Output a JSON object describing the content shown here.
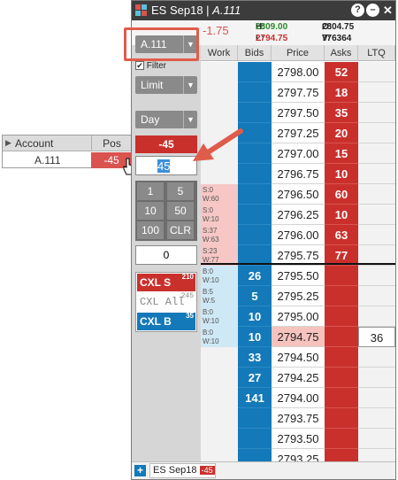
{
  "colors": {
    "ask_red": "#c9302c",
    "bid_blue": "#1479b8",
    "title_bg": "#3c3c3c",
    "accent_red": "#d9534f",
    "highlight": "#e05c4a"
  },
  "popup": {
    "header": {
      "account": "Account",
      "pos": "Pos"
    },
    "row": {
      "account": "A.111",
      "pos": "-45"
    }
  },
  "window": {
    "title_symbol": "ES Sep18 | ",
    "title_account": "A.111",
    "buttons": {
      "help": "?",
      "minimize": "–",
      "close": "✕"
    }
  },
  "stats": {
    "change": "-1.75",
    "high_label": "H:",
    "high": "2809.00",
    "open_label": "O:",
    "open": "2804.75",
    "low_label": "L:",
    "low": "2794.75",
    "volume_label": "V:",
    "volume": "776364"
  },
  "controls": {
    "account_select": "A.111",
    "filter_label": "Filter",
    "order_type": "Limit",
    "tif": "Day",
    "position": "-45",
    "quantity": "45",
    "qty_buttons": [
      "1",
      "5",
      "10",
      "50",
      "100",
      "CLR"
    ],
    "qty_offset": "0",
    "cxl_s": {
      "label": "CXL S",
      "count": "210"
    },
    "cxl_all": {
      "label": "CXL All",
      "count": "245"
    },
    "cxl_b": {
      "label": "CXL B",
      "count": "35"
    }
  },
  "ladder": {
    "columns": [
      "Work",
      "Bids",
      "Price",
      "Asks",
      "LTQ"
    ],
    "rows": [
      {
        "work": "",
        "bid": "",
        "price": "2798.00",
        "ask": "52",
        "ltq": ""
      },
      {
        "work": "",
        "bid": "",
        "price": "2797.75",
        "ask": "18",
        "ltq": ""
      },
      {
        "work": "",
        "bid": "",
        "price": "2797.50",
        "ask": "35",
        "ltq": ""
      },
      {
        "work": "",
        "bid": "",
        "price": "2797.25",
        "ask": "20",
        "ltq": ""
      },
      {
        "work": "",
        "bid": "",
        "price": "2797.00",
        "ask": "15",
        "ltq": ""
      },
      {
        "work": "",
        "bid": "",
        "price": "2796.75",
        "ask": "10",
        "ltq": ""
      },
      {
        "work": "S:0 W:60",
        "bid": "",
        "price": "2796.50",
        "ask": "60",
        "ltq": ""
      },
      {
        "work": "S:0 W:10",
        "bid": "",
        "price": "2796.25",
        "ask": "10",
        "ltq": ""
      },
      {
        "work": "S:37 W:63",
        "bid": "",
        "price": "2796.00",
        "ask": "63",
        "ltq": ""
      },
      {
        "work": "S:23 W:77",
        "bid": "",
        "price": "2795.75",
        "ask": "77",
        "ltq": ""
      },
      {
        "work": "B:0 W:10",
        "bid": "26",
        "price": "2795.50",
        "ask": "",
        "ltq": ""
      },
      {
        "work": "B:5 W:5",
        "bid": "5",
        "price": "2795.25",
        "ask": "",
        "ltq": ""
      },
      {
        "work": "B:0 W:10",
        "bid": "10",
        "price": "2795.00",
        "ask": "",
        "ltq": ""
      },
      {
        "work": "B:0 W:10",
        "bid": "10",
        "price": "2794.75",
        "ask": "",
        "ltq": "36"
      },
      {
        "work": "",
        "bid": "33",
        "price": "2794.50",
        "ask": "",
        "ltq": ""
      },
      {
        "work": "",
        "bid": "27",
        "price": "2794.25",
        "ask": "",
        "ltq": ""
      },
      {
        "work": "",
        "bid": "141",
        "price": "2794.00",
        "ask": "",
        "ltq": ""
      },
      {
        "work": "",
        "bid": "",
        "price": "2793.75",
        "ask": "",
        "ltq": ""
      },
      {
        "work": "",
        "bid": "",
        "price": "2793.50",
        "ask": "",
        "ltq": ""
      },
      {
        "work": "",
        "bid": "",
        "price": "2793.25",
        "ask": "",
        "ltq": ""
      }
    ]
  },
  "statusbar": {
    "add": "+",
    "tab_label": "ES Sep18",
    "tab_pos": "-45"
  }
}
